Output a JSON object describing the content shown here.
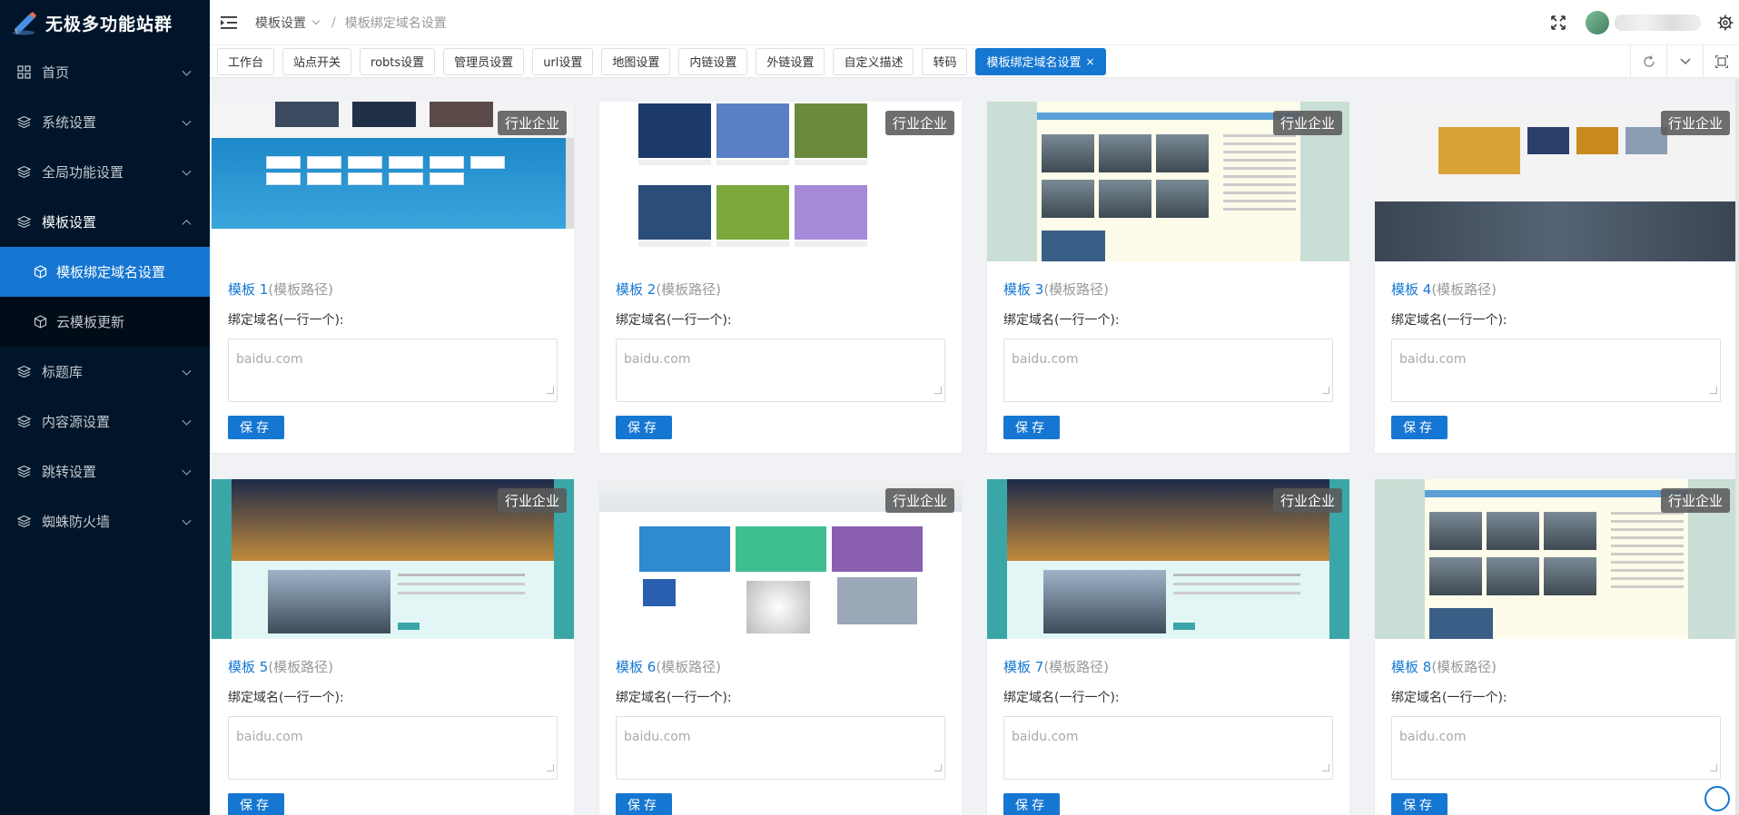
{
  "brand": {
    "title": "无极多功能站群"
  },
  "sidebar": {
    "items": [
      {
        "label": "首页",
        "icon": "grid-icon",
        "open": false
      },
      {
        "label": "系统设置",
        "icon": "layers-icon",
        "open": false
      },
      {
        "label": "全局功能设置",
        "icon": "layers-icon",
        "open": false
      },
      {
        "label": "模板设置",
        "icon": "layers-icon",
        "open": true,
        "children": [
          {
            "label": "模板绑定域名设置",
            "icon": "cube-icon",
            "active": true
          },
          {
            "label": "云模板更新",
            "icon": "cube-icon",
            "active": false
          }
        ]
      },
      {
        "label": "标题库",
        "icon": "layers-icon",
        "open": false
      },
      {
        "label": "内容源设置",
        "icon": "layers-icon",
        "open": false
      },
      {
        "label": "跳转设置",
        "icon": "layers-icon",
        "open": false
      },
      {
        "label": "蜘蛛防火墙",
        "icon": "layers-icon",
        "open": false
      }
    ]
  },
  "header": {
    "breadcrumb": {
      "parent": "模板设置",
      "separator": "/",
      "current": "模板绑定域名设置"
    }
  },
  "tabs": [
    {
      "label": "工作台"
    },
    {
      "label": "站点开关"
    },
    {
      "label": "robts设置"
    },
    {
      "label": "管理员设置"
    },
    {
      "label": "url设置"
    },
    {
      "label": "地图设置"
    },
    {
      "label": "内链设置"
    },
    {
      "label": "外链设置"
    },
    {
      "label": "自定义描述"
    },
    {
      "label": "转码"
    },
    {
      "label": "模板绑定域名设置",
      "active": true,
      "close": "×"
    }
  ],
  "cards": [
    {
      "name": "模板 1",
      "path": "(模板路径)",
      "badge": "行业企业",
      "field_label": "绑定域名(一行一个):",
      "placeholder": "baidu.com",
      "value": "",
      "save_label": "保存",
      "theme": "blue-brands"
    },
    {
      "name": "模板 2",
      "path": "(模板路径)",
      "badge": "行业企业",
      "field_label": "绑定域名(一行一个):",
      "placeholder": "baidu.com",
      "value": "",
      "save_label": "保存",
      "theme": "photo-grid"
    },
    {
      "name": "模板 3",
      "path": "(模板路径)",
      "badge": "行业企业",
      "field_label": "绑定域名(一行一个):",
      "placeholder": "baidu.com",
      "value": "",
      "save_label": "保存",
      "theme": "mountain"
    },
    {
      "name": "模板 4",
      "path": "(模板路径)",
      "badge": "行业企业",
      "field_label": "绑定域名(一行一个):",
      "placeholder": "baidu.com",
      "value": "",
      "save_label": "保存",
      "theme": "industry"
    },
    {
      "name": "模板 5",
      "path": "(模板路径)",
      "badge": "行业企业",
      "field_label": "绑定域名(一行一个):",
      "placeholder": "baidu.com",
      "value": "",
      "save_label": "保存",
      "theme": "city"
    },
    {
      "name": "模板 6",
      "path": "(模板路径)",
      "badge": "行业企业",
      "field_label": "绑定域名(一行一个):",
      "placeholder": "baidu.com",
      "value": "",
      "save_label": "保存",
      "theme": "tech"
    },
    {
      "name": "模板 7",
      "path": "(模板路径)",
      "badge": "行业企业",
      "field_label": "绑定域名(一行一个):",
      "placeholder": "baidu.com",
      "value": "",
      "save_label": "保存",
      "theme": "city"
    },
    {
      "name": "模板 8",
      "path": "(模板路径)",
      "badge": "行业企业",
      "field_label": "绑定域名(一行一个):",
      "placeholder": "baidu.com",
      "value": "",
      "save_label": "保存",
      "theme": "mountain"
    }
  ],
  "colors": {
    "sidebar_bg": "#001529",
    "accent": "#1677d2",
    "page_bg": "#f0f2f5"
  }
}
